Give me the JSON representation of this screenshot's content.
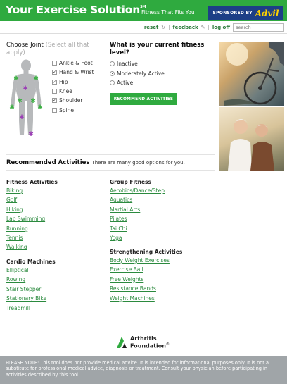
{
  "header": {
    "title": "Your Exercise Solution",
    "title_mark": "SM",
    "tagline": "Fitness That Fits You",
    "sponsor_label": "SPONSORED BY",
    "sponsor_brand": "Advil"
  },
  "toolbar": {
    "reset": "reset",
    "feedback": "feedback",
    "logoff": "log off",
    "search_placeholder": "search"
  },
  "joints": {
    "title": "Choose Joint",
    "hint": "(Select all that apply)",
    "items": [
      {
        "label": "Ankle & Foot",
        "checked": false
      },
      {
        "label": "Hand & Wrist",
        "checked": true
      },
      {
        "label": "Hip",
        "checked": true
      },
      {
        "label": "Knee",
        "checked": false
      },
      {
        "label": "Shoulder",
        "checked": true
      },
      {
        "label": "Spine",
        "checked": false
      }
    ],
    "check_glyph": "✓"
  },
  "fitness": {
    "question": "What is your current fitness level?",
    "options": [
      {
        "label": "Inactive",
        "selected": false
      },
      {
        "label": "Moderately Active",
        "selected": true
      },
      {
        "label": "Active",
        "selected": false
      }
    ],
    "button": "RECOMMEND ACTIVITIES"
  },
  "recommended": {
    "title": "Recommended Activities",
    "subtitle": "There are many good options for you."
  },
  "categories": {
    "fitness": {
      "title": "Fitness Activities",
      "items": [
        "Biking",
        "Golf",
        "Hiking",
        "Lap Swimming",
        "Running",
        "Tennis",
        "Walking"
      ]
    },
    "cardio": {
      "title": "Cardio Machines",
      "items": [
        "Elliptical",
        "Rowing",
        "Stair Stepper",
        "Stationary Bike",
        "Treadmill"
      ]
    },
    "group": {
      "title": "Group Fitness",
      "items": [
        "Aerobics/Dance/Step",
        "Aquatics",
        "Martial Arts",
        "Pilates",
        "Tai Chi",
        "Yoga"
      ]
    },
    "strength": {
      "title": "Strengthening Activities",
      "items": [
        "Body Weight Exercises",
        "Exercise Ball",
        "Free Weights",
        "Resistance Bands",
        "Weight Machines"
      ]
    }
  },
  "logo": {
    "line1": "Arthritis",
    "line2": "Foundation",
    "mark": "®"
  },
  "footer": {
    "note": "PLEASE NOTE: This tool does not provide medical advice. It is intended for informational purposes only. It is not a substitute for professional medical advice, diagnosis or treatment. Consult your physician before participating in activities described by this tool."
  },
  "colors": {
    "brand_green": "#2faa3f",
    "link_green": "#2b8a3e",
    "marker_green": "#3cb043",
    "marker_purple": "#9b3fb5",
    "sponsor_blue": "#1d3f86",
    "footer_gray": "#a0a5a8"
  },
  "icons": {
    "reset": "refresh-icon",
    "feedback": "pencil-icon"
  }
}
